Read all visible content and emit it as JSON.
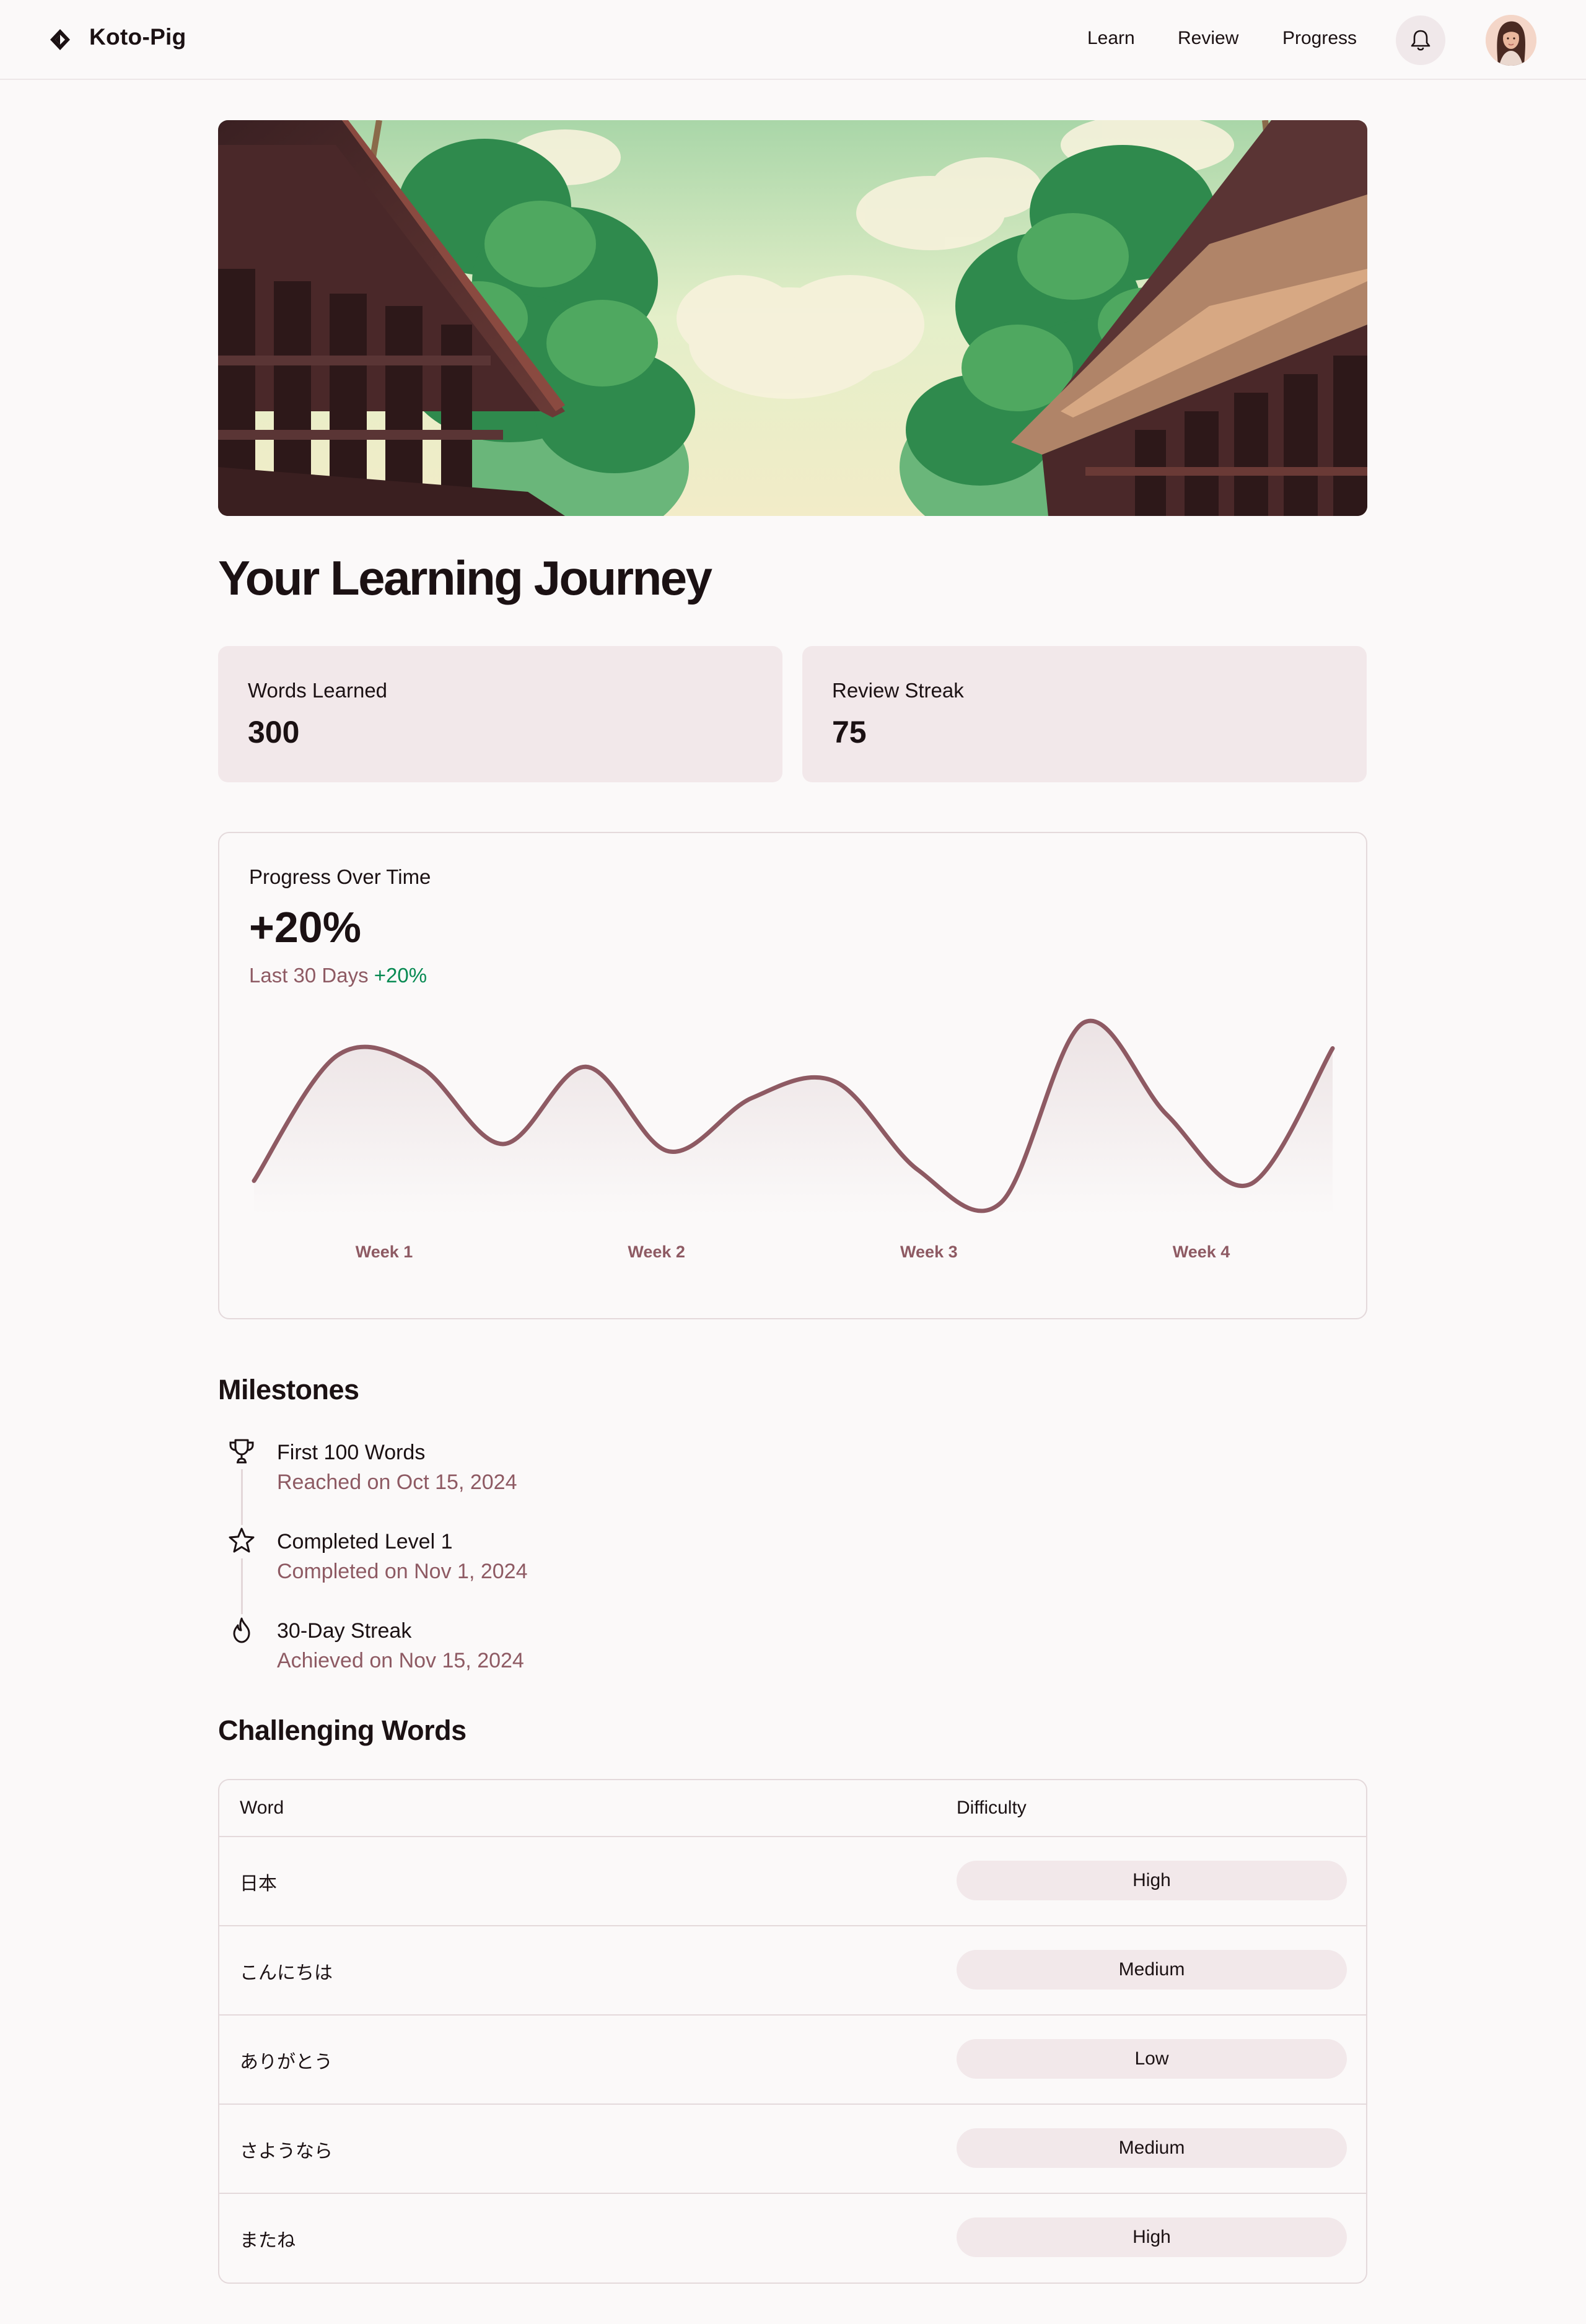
{
  "app": {
    "brand": "Koto-Pig"
  },
  "nav": {
    "learn": "Learn",
    "review": "Review",
    "progress": "Progress"
  },
  "icons": {
    "logo": "diamond-logo-icon",
    "notifications": "bell-icon",
    "milestones": [
      "trophy-icon",
      "star-icon",
      "flame-icon"
    ]
  },
  "colors": {
    "accent": "#8e5a63",
    "positive": "#078a52",
    "card": "#f2e8ea",
    "page": "#fbf9f9"
  },
  "page": {
    "title": "Your Learning Journey"
  },
  "stats": {
    "words": {
      "label": "Words Learned",
      "value": "300"
    },
    "streak": {
      "label": "Review Streak",
      "value": "75"
    }
  },
  "progress": {
    "label": "Progress Over Time",
    "value": "+20%",
    "period": "Last 30 Days",
    "delta": "+20%"
  },
  "chart_data": {
    "type": "line",
    "categories": [
      "Week 1",
      "Week 2",
      "Week 3",
      "Week 4"
    ],
    "series": [
      {
        "values": [
          0.12,
          0.8,
          0.74,
          0.32,
          0.74,
          0.28,
          0.57,
          0.66,
          0.18,
          0.0,
          0.98,
          0.48,
          0.1,
          0.84
        ]
      }
    ],
    "ylim": [
      0,
      1
    ],
    "grid": false,
    "xlabel": "",
    "ylabel": ""
  },
  "milestones": {
    "title": "Milestones",
    "items": [
      {
        "name": "First 100 Words",
        "date": "Reached on Oct 15, 2024"
      },
      {
        "name": "Completed Level 1",
        "date": "Completed on Nov 1, 2024"
      },
      {
        "name": "30-Day Streak",
        "date": "Achieved on Nov 15, 2024"
      }
    ]
  },
  "words": {
    "title": "Challenging Words",
    "headers": {
      "word": "Word",
      "difficulty": "Difficulty"
    },
    "rows": [
      {
        "word": "日本",
        "difficulty": "High"
      },
      {
        "word": "こんにちは",
        "difficulty": "Medium"
      },
      {
        "word": "ありがとう",
        "difficulty": "Low"
      },
      {
        "word": "さようなら",
        "difficulty": "Medium"
      },
      {
        "word": "またね",
        "difficulty": "High"
      }
    ]
  }
}
